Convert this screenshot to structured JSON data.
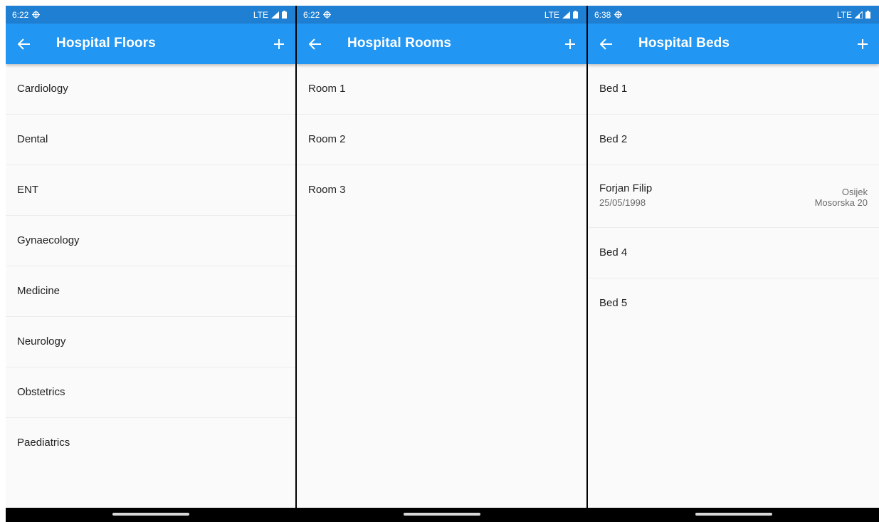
{
  "colors": {
    "status_bar": "#1f7fd2",
    "app_bar": "#2296f3",
    "background": "#fafafa",
    "nav_bar": "#000000"
  },
  "screens": [
    {
      "status": {
        "time": "6:22",
        "network": "LTE"
      },
      "title": "Hospital Floors",
      "items": [
        "Cardiology",
        "Dental",
        "ENT",
        "Gynaecology",
        "Medicine",
        "Neurology",
        "Obstetrics",
        "Paediatrics"
      ]
    },
    {
      "status": {
        "time": "6:22",
        "network": "LTE"
      },
      "title": "Hospital Rooms",
      "items": [
        "Room 1",
        "Room 2",
        "Room 3"
      ]
    },
    {
      "status": {
        "time": "6:38",
        "network": "LTE"
      },
      "title": "Hospital Beds",
      "items": [
        {
          "label": "Bed 1"
        },
        {
          "label": "Bed 2"
        },
        {
          "label": "Forjan Filip",
          "date": "25/05/1998",
          "city": "Osijek",
          "address": "Mosorska 20"
        },
        {
          "label": "Bed 4"
        },
        {
          "label": "Bed 5"
        }
      ]
    }
  ],
  "icons": {
    "back": "arrow-left-icon",
    "add": "plus-icon",
    "gps": "gps-icon",
    "signal": "signal-icon",
    "battery": "battery-icon"
  }
}
